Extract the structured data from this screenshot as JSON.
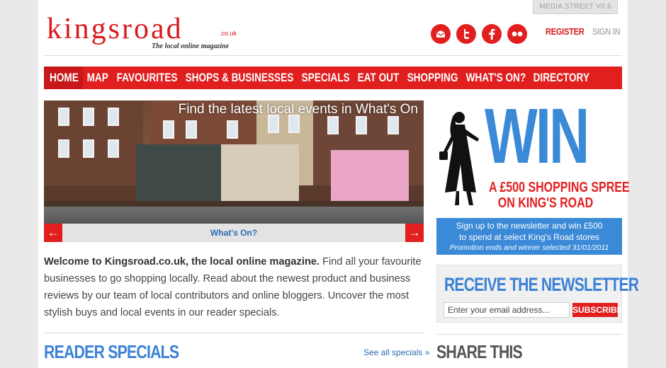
{
  "header": {
    "version": "MEDIA STREET V0.6",
    "logo_word": "kingsroad",
    "logo_couk": ".co.uk",
    "tagline": "The local online magazine",
    "register": "REGISTER",
    "signin": "SIGN IN",
    "social": [
      "email-icon",
      "twitter-icon",
      "facebook-icon",
      "flickr-icon"
    ]
  },
  "nav": {
    "items": [
      "HOME",
      "MAP",
      "FAVOURITES",
      "SHOPS & BUSINESSES",
      "SPECIALS",
      "EAT OUT",
      "SHOPPING",
      "WHAT'S ON?",
      "DIRECTORY"
    ]
  },
  "hero": {
    "caption": "Find the latest local events in What's On",
    "slider_label": "What's On?",
    "prev_arrow": "←",
    "next_arrow": "→"
  },
  "intro": {
    "lead": "Welcome to Kingsroad.co.uk, the local online magazine.",
    "body": " Find all your favourite businesses to go shopping locally. Read about the newest product and business reviews by our team of local contributors and online bloggers. Uncover the most stylish buys and local events in our reader specials."
  },
  "reader_specials": {
    "title": "READER SPECIALS",
    "see_all": "See all specials »"
  },
  "promo": {
    "win": "WIN",
    "prize_line1": "A £500 SHOPPING SPREE",
    "prize_line2": "ON KING'S ROAD",
    "box_line1": "Sign up to the newsletter and win £500",
    "box_line2": "to spend at select King's Road stores",
    "box_line3": "Promotion ends and winner selected  31/01/2011"
  },
  "newsletter": {
    "title": "RECEIVE THE NEWSLETTER",
    "placeholder": "Enter your email address...",
    "subscribe": "SUBSCRIBE"
  },
  "share": {
    "title": "SHARE THIS"
  },
  "colors": {
    "brand_red": "#e21f1f",
    "brand_blue": "#3b82d6"
  }
}
